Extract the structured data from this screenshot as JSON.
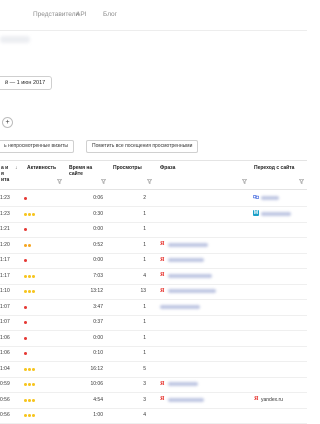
{
  "nav": {
    "items": [
      "Представители",
      "API",
      "Блог"
    ]
  },
  "date_range": "й — 1 июн 2017",
  "add_button": "+",
  "buttons": {
    "show_unviewed": "ь непросмотренные визиты",
    "mark_all_viewed": "Пометить все посещения просмотренными"
  },
  "table": {
    "headers": {
      "time": "а и\nя\nита",
      "activity": "Активность",
      "duration": "Время на\nсайте",
      "views": "Просмотры",
      "phrase": "Фраза",
      "source": "Переход с сайта"
    },
    "sort_indicator": "↓",
    "rows": [
      {
        "time": "1:23",
        "activity": 1,
        "duration": "0:06",
        "views": "2",
        "phrase": "",
        "phrase_yandex": false,
        "source_icon": "link",
        "source": ""
      },
      {
        "time": "1:23",
        "activity": 3,
        "duration": "0:30",
        "views": "1",
        "phrase": "",
        "phrase_yandex": false,
        "source_icon": "m",
        "source": ""
      },
      {
        "time": "1:21",
        "activity": 1,
        "duration": "0:00",
        "views": "1",
        "phrase": "",
        "phrase_yandex": false,
        "source_icon": "",
        "source": ""
      },
      {
        "time": "1:20",
        "activity": 2,
        "duration": "0:52",
        "views": "1",
        "phrase": "",
        "phrase_yandex": true,
        "source_icon": "",
        "source": ""
      },
      {
        "time": "1:17",
        "activity": 1,
        "duration": "0:00",
        "views": "1",
        "phrase": "",
        "phrase_yandex": true,
        "source_icon": "",
        "source": ""
      },
      {
        "time": "1:17",
        "activity": 3,
        "duration": "7:03",
        "views": "4",
        "phrase": "",
        "phrase_yandex": true,
        "source_icon": "",
        "source": ""
      },
      {
        "time": "1:10",
        "activity": 3,
        "duration": "13:12",
        "views": "13",
        "phrase": "",
        "phrase_yandex": true,
        "source_icon": "",
        "source": ""
      },
      {
        "time": "1:07",
        "activity": 1,
        "duration": "3:47",
        "views": "1",
        "phrase": "",
        "phrase_yandex": false,
        "source_icon": "",
        "source": ""
      },
      {
        "time": "1:07",
        "activity": 1,
        "duration": "0:37",
        "views": "1",
        "phrase": "",
        "phrase_yandex": false,
        "source_icon": "",
        "source": ""
      },
      {
        "time": "1:06",
        "activity": 1,
        "duration": "0:00",
        "views": "1",
        "phrase": "",
        "phrase_yandex": false,
        "source_icon": "",
        "source": ""
      },
      {
        "time": "1:06",
        "activity": 1,
        "duration": "0:10",
        "views": "1",
        "phrase": "",
        "phrase_yandex": false,
        "source_icon": "",
        "source": ""
      },
      {
        "time": "1:04",
        "activity": 3,
        "duration": "16:12",
        "views": "5",
        "phrase": "",
        "phrase_yandex": false,
        "source_icon": "",
        "source": ""
      },
      {
        "time": "0:59",
        "activity": 3,
        "duration": "10:06",
        "views": "3",
        "phrase": "",
        "phrase_yandex": true,
        "source_icon": "",
        "source": ""
      },
      {
        "time": "0:56",
        "activity": 3,
        "duration": "4:54",
        "views": "3",
        "phrase": "",
        "phrase_yandex": true,
        "source_icon": "yandex",
        "source": "yandex.ru"
      },
      {
        "time": "0:56",
        "activity": 3,
        "duration": "1:00",
        "views": "4",
        "phrase": "",
        "phrase_yandex": false,
        "source_icon": "",
        "source": ""
      }
    ]
  },
  "colors": {
    "activity_low": "#e53935",
    "activity_mid": "#f5a623",
    "activity_high": "#f7c51e",
    "yandex_red": "#e52620",
    "link_icon": "#4a6ee0",
    "m_icon": "#1aa0c8"
  }
}
